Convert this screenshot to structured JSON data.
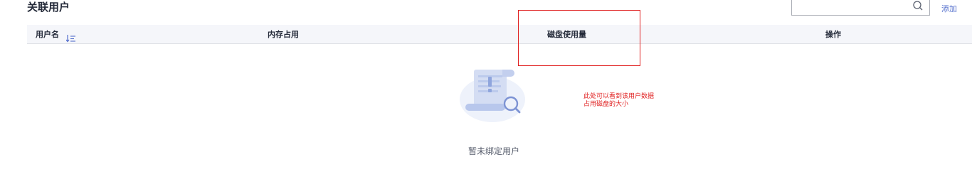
{
  "section": {
    "title": "关联用户"
  },
  "toolbar": {
    "search_placeholder": "",
    "search_value": "",
    "add_label": "添加"
  },
  "table": {
    "columns": [
      {
        "label": "用户名",
        "sortable": true
      },
      {
        "label": "内存占用",
        "sortable": false
      },
      {
        "label": "磁盘使用量",
        "sortable": false
      },
      {
        "label": "操作",
        "sortable": false
      }
    ],
    "rows": []
  },
  "empty_state": {
    "text": "暂未绑定用户",
    "icon": "empty-document-search-icon"
  },
  "annotation": {
    "text": "此处可以看到该用户数据\n占用磁盘的大小",
    "color": "#e02020"
  },
  "colors": {
    "accent": "#526ecc",
    "header_bg": "#f5f6fa",
    "annotation_red": "#e02020"
  }
}
